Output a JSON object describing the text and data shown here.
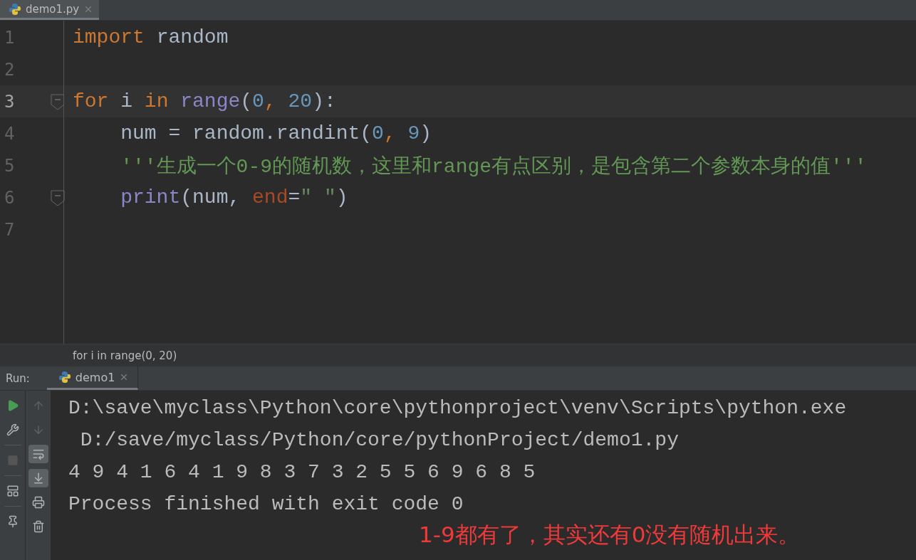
{
  "editor_tabs": [
    {
      "label": "demo1.py",
      "selected": true
    }
  ],
  "code_lines": [
    {
      "number": "1",
      "current": false,
      "fold": false,
      "tokens": [
        {
          "kind": "keyword",
          "text": "import"
        },
        {
          "kind": "plain",
          "text": " random"
        }
      ]
    },
    {
      "number": "2",
      "current": false,
      "fold": false
    },
    {
      "number": "3",
      "current": true,
      "fold": true,
      "tokens": [
        {
          "kind": "keyword",
          "text": "for"
        },
        {
          "kind": "plain",
          "text": " i "
        },
        {
          "kind": "keyword",
          "text": "in"
        },
        {
          "kind": "builtin",
          "text": " range"
        },
        {
          "kind": "plain",
          "text": "("
        },
        {
          "kind": "number",
          "text": "0"
        },
        {
          "kind": "keyword",
          "text": ","
        },
        {
          "kind": "number",
          "text": " 20"
        },
        {
          "kind": "plain",
          "text": "):"
        }
      ]
    },
    {
      "number": "4",
      "current": false,
      "fold": false,
      "tokens": [
        {
          "kind": "plain",
          "text": "    num = random.randint("
        },
        {
          "kind": "number",
          "text": "0"
        },
        {
          "kind": "keyword",
          "text": ","
        },
        {
          "kind": "number",
          "text": " 9"
        },
        {
          "kind": "plain",
          "text": ")"
        }
      ]
    },
    {
      "number": "5",
      "current": false,
      "fold": false,
      "tokens": [
        {
          "kind": "docstring",
          "text": "    '''生成一个0-9的随机数，这里和range有点区别，是包含第二个参数本身的值'''"
        }
      ]
    },
    {
      "number": "6",
      "current": false,
      "fold": true,
      "tokens": [
        {
          "kind": "builtin",
          "text": "    print"
        },
        {
          "kind": "plain",
          "text": "(num, "
        },
        {
          "kind": "param",
          "text": "end"
        },
        {
          "kind": "plain",
          "text": "="
        },
        {
          "kind": "string",
          "text": "\" \""
        },
        {
          "kind": "plain",
          "text": ")"
        }
      ]
    },
    {
      "number": "7",
      "current": false,
      "fold": false
    }
  ],
  "breadcrumb": "for i in range(0, 20)",
  "run_panel": {
    "label": "Run:",
    "tabs": [
      {
        "label": "demo1",
        "selected": true
      }
    ],
    "output": [
      "D:\\save\\myclass\\Python\\core\\pythonproject\\venv\\Scripts\\python.exe",
      " D:/save/myclass/Python/core/pythonProject/demo1.py",
      "4 9 4 1 6 4 1 9 8 3 7 3 2 5 5 6 9 6 8 5",
      "Process finished with exit code 0"
    ],
    "soft_wrap": {
      "on": true
    },
    "scroll_to_end": {
      "on": true
    }
  },
  "annotation": "1-9都有了，其实还有0没有随机出来。"
}
